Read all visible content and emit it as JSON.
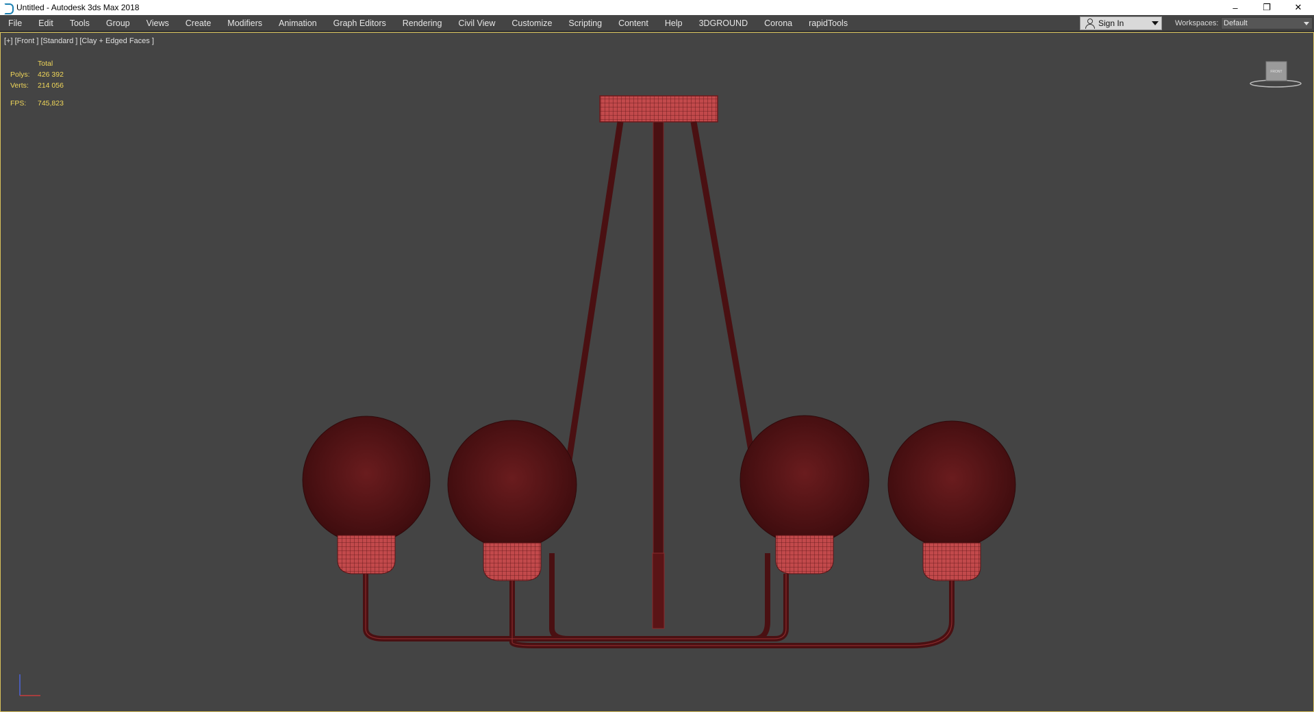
{
  "window": {
    "title": "Untitled - Autodesk 3ds Max 2018",
    "controls": {
      "minimize": "–",
      "restore": "❐",
      "close": "✕"
    }
  },
  "menu": {
    "items": [
      "File",
      "Edit",
      "Tools",
      "Group",
      "Views",
      "Create",
      "Modifiers",
      "Animation",
      "Graph Editors",
      "Rendering",
      "Civil View",
      "Customize",
      "Scripting",
      "Content",
      "Help",
      "3DGROUND",
      "Corona",
      "rapidTools"
    ]
  },
  "account": {
    "sign_in_label": "Sign In"
  },
  "workspaces": {
    "label": "Workspaces:",
    "value": "Default"
  },
  "viewport": {
    "label": "[+] [Front ] [Standard ] [Clay + Edged Faces ]",
    "stats": {
      "header": "Total",
      "polys_label": "Polys:",
      "polys_value": "426 392",
      "verts_label": "Verts:",
      "verts_value": "214 056",
      "fps_label": "FPS:",
      "fps_value": "745,823"
    },
    "viewcube_label": "FRONT"
  },
  "colors": {
    "viewport_bg": "#444444",
    "model_dark": "#4a1012",
    "model_light": "#c2494b",
    "active_border": "#d8c15a",
    "stats_text": "#f2d85a"
  }
}
